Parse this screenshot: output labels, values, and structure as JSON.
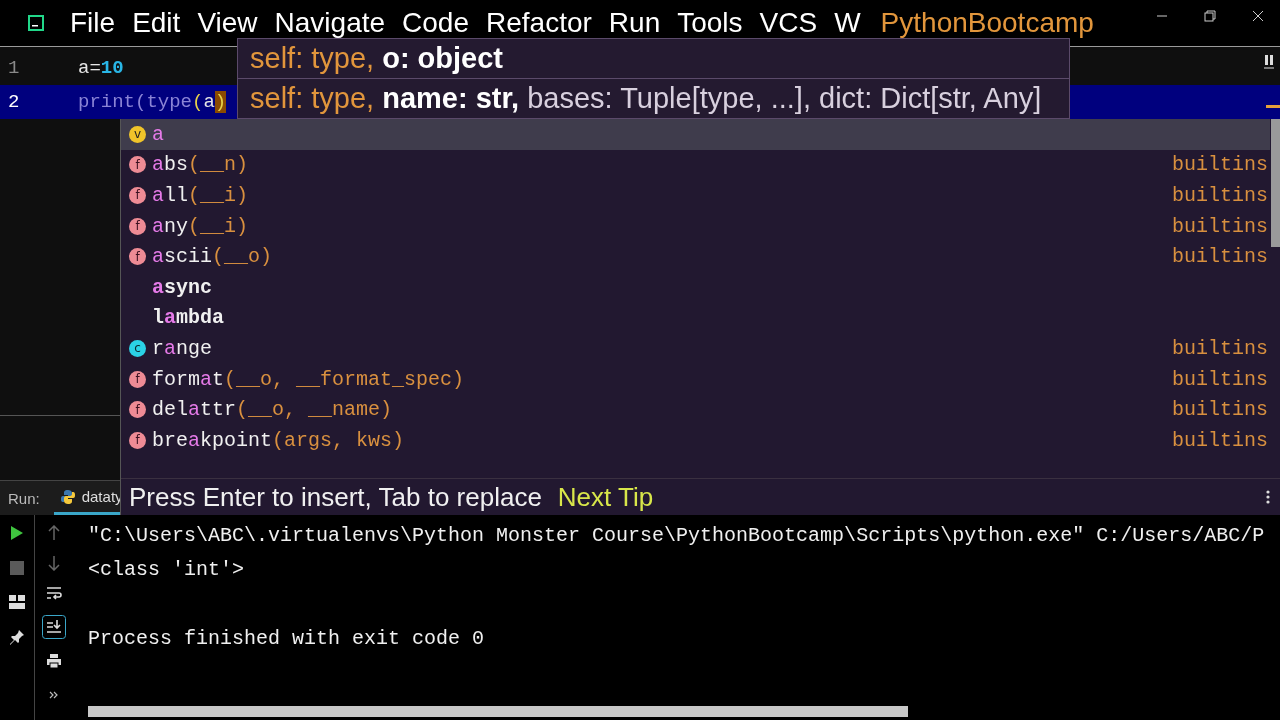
{
  "menu": [
    "File",
    "Edit",
    "View",
    "Navigate",
    "Code",
    "Refactor",
    "Run",
    "Tools",
    "VCS",
    "W"
  ],
  "project_title": "PythonBootcamp",
  "editor": {
    "lines": [
      {
        "number": "1",
        "current": false,
        "tokens": [
          {
            "kind": "plain",
            "text": "a="
          },
          {
            "kind": "number",
            "text": "10"
          }
        ]
      },
      {
        "number": "2",
        "current": true,
        "tokens": [
          {
            "kind": "call",
            "text": "print(type"
          },
          {
            "kind": "bracket",
            "text": "("
          },
          {
            "kind": "plain",
            "text": "a"
          },
          {
            "kind": "matched",
            "text": ")"
          }
        ]
      }
    ]
  },
  "signatures": [
    {
      "before": "self: type, ",
      "current": "o: object"
    },
    {
      "before": "self: type, ",
      "current": "name: str,",
      "after": " bases: Tuple[type, ...], dict: Dict[str, Any]"
    }
  ],
  "completion": {
    "items": [
      {
        "kind": "variable",
        "badge": "v",
        "selected": true,
        "match": "a"
      },
      {
        "kind": "function",
        "badge": "f",
        "selected": false,
        "match": "a",
        "after": "bs",
        "params": "(__n)",
        "source": "builtins"
      },
      {
        "kind": "function",
        "badge": "f",
        "selected": false,
        "match": "a",
        "after": "ll",
        "params": "(__i)",
        "source": "builtins"
      },
      {
        "kind": "function",
        "badge": "f",
        "selected": false,
        "match": "a",
        "after": "ny",
        "params": "(__i)",
        "source": "builtins"
      },
      {
        "kind": "function",
        "badge": "f",
        "selected": false,
        "match": "a",
        "after": "scii",
        "params": "(__o)",
        "source": "builtins"
      },
      {
        "kind": "keyword",
        "selected": false,
        "match": "a",
        "after": "sync"
      },
      {
        "kind": "keyword",
        "selected": false,
        "before": "l",
        "match": "a",
        "after": "mbda"
      },
      {
        "kind": "class",
        "badge": "c",
        "selected": false,
        "before": "r",
        "match": "a",
        "after": "nge",
        "source": "builtins"
      },
      {
        "kind": "function",
        "badge": "f",
        "selected": false,
        "before": "form",
        "match": "a",
        "after": "t",
        "params": "(__o, __format_spec)",
        "source": "builtins"
      },
      {
        "kind": "function",
        "badge": "f",
        "selected": false,
        "before": "del",
        "match": "a",
        "after": "ttr",
        "params": "(__o, __name)",
        "source": "builtins"
      },
      {
        "kind": "function",
        "badge": "f",
        "selected": false,
        "before": "bre",
        "match": "a",
        "after": "kpoint",
        "params": "(args, kws)",
        "source": "builtins"
      }
    ],
    "hint": "Press Enter to insert, Tab to replace",
    "tip_link": "Next Tip"
  },
  "run": {
    "label": "Run:",
    "tab": "dataty",
    "output": [
      "\"C:\\Users\\ABC\\.virtualenvs\\Python Monster Course\\PythonBootcamp\\Scripts\\python.exe\" C:/Users/ABC/P",
      "<class 'int'>"
    ],
    "exit_message": "Process finished with exit code 0"
  }
}
